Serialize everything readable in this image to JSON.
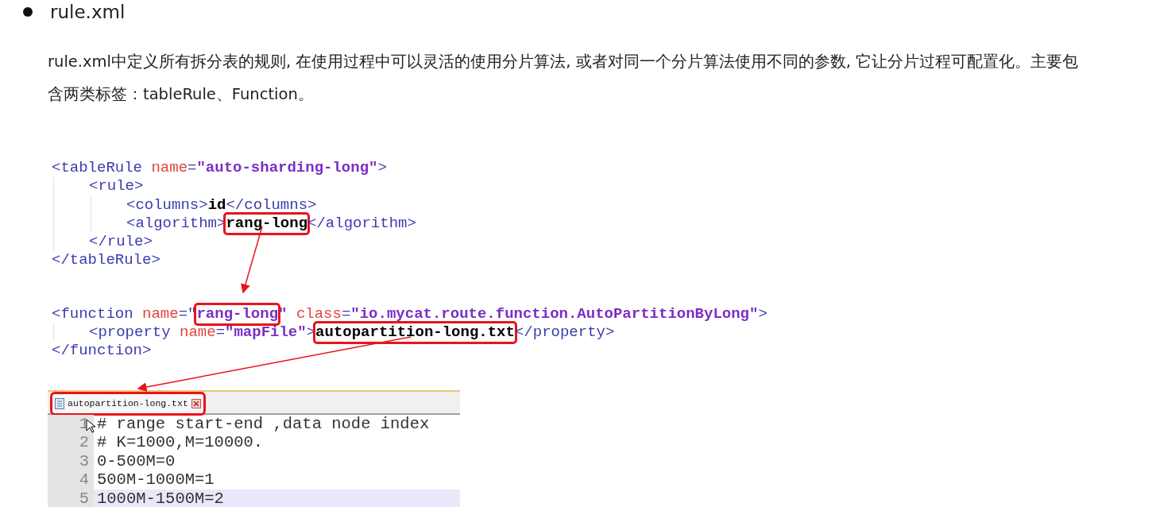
{
  "heading": {
    "title": "rule.xml"
  },
  "description": "rule.xml中定义所有拆分表的规则, 在使用过程中可以灵活的使用分片算法, 或者对同一个分片算法使用不同的参数, 它让分片过程可配置化。主要包含两类标签：tableRule、Function。",
  "code_blocks": [
    {
      "lines": [
        {
          "tokens": [
            {
              "kind": "tag",
              "text": "<tableRule "
            },
            {
              "kind": "attr",
              "text": "name"
            },
            {
              "kind": "tag",
              "text": "="
            },
            {
              "kind": "value",
              "text": "\"auto-sharding-long\""
            },
            {
              "kind": "tag",
              "text": ">"
            }
          ],
          "children": [
            {
              "tokens": [
                {
                  "kind": "tag",
                  "text": "<rule>"
                }
              ],
              "children": [
                {
                  "tokens": [
                    {
                      "kind": "tag",
                      "text": "<columns>"
                    },
                    {
                      "kind": "text",
                      "text": "id"
                    },
                    {
                      "kind": "tag",
                      "text": "</columns>"
                    }
                  ]
                },
                {
                  "tokens": [
                    {
                      "kind": "tag",
                      "text": "<algorithm>"
                    },
                    {
                      "kind": "text",
                      "text": "rang-long",
                      "boxed": true
                    },
                    {
                      "kind": "tag",
                      "text": "</algorithm>"
                    }
                  ]
                }
              ]
            },
            {
              "tokens": [
                {
                  "kind": "tag",
                  "text": "</rule>"
                }
              ]
            }
          ]
        },
        {
          "tokens": [
            {
              "kind": "tag",
              "text": "</tableRule>"
            }
          ]
        }
      ]
    },
    {
      "lines": [
        {
          "tokens": [
            {
              "kind": "tag",
              "text": "<function "
            },
            {
              "kind": "attr",
              "text": "name"
            },
            {
              "kind": "tag",
              "text": "=\""
            },
            {
              "kind": "value",
              "text": "rang-long",
              "boxed": true
            },
            {
              "kind": "value",
              "text": "\" "
            },
            {
              "kind": "attr",
              "text": "class"
            },
            {
              "kind": "tag",
              "text": "="
            },
            {
              "kind": "value",
              "text": "\"io.mycat.route.function.AutoPartitionByLong\""
            },
            {
              "kind": "tag",
              "text": ">"
            }
          ],
          "children": [
            {
              "tokens": [
                {
                  "kind": "tag",
                  "text": "<property "
                },
                {
                  "kind": "attr",
                  "text": "name"
                },
                {
                  "kind": "tag",
                  "text": "="
                },
                {
                  "kind": "value",
                  "text": "\"mapFile\""
                },
                {
                  "kind": "tag",
                  "text": ">"
                },
                {
                  "kind": "text",
                  "text": "autopartition-long.txt",
                  "boxed": true
                },
                {
                  "kind": "tag",
                  "text": "</property>"
                }
              ]
            }
          ]
        },
        {
          "tokens": [
            {
              "kind": "tag",
              "text": "</function>"
            }
          ]
        }
      ]
    }
  ],
  "editor": {
    "tab": {
      "title": "autopartition-long.txt",
      "boxed": true
    },
    "lines": [
      {
        "number": "1",
        "text": "# range start-end ,data node index",
        "current": false
      },
      {
        "number": "2",
        "text": "# K=1000,M=10000.",
        "current": false
      },
      {
        "number": "3",
        "text": "0-500M=0",
        "current": false
      },
      {
        "number": "4",
        "text": "500M-1000M=1",
        "current": false
      },
      {
        "number": "5",
        "text": "1000M-1500M=2",
        "current": true
      }
    ]
  }
}
